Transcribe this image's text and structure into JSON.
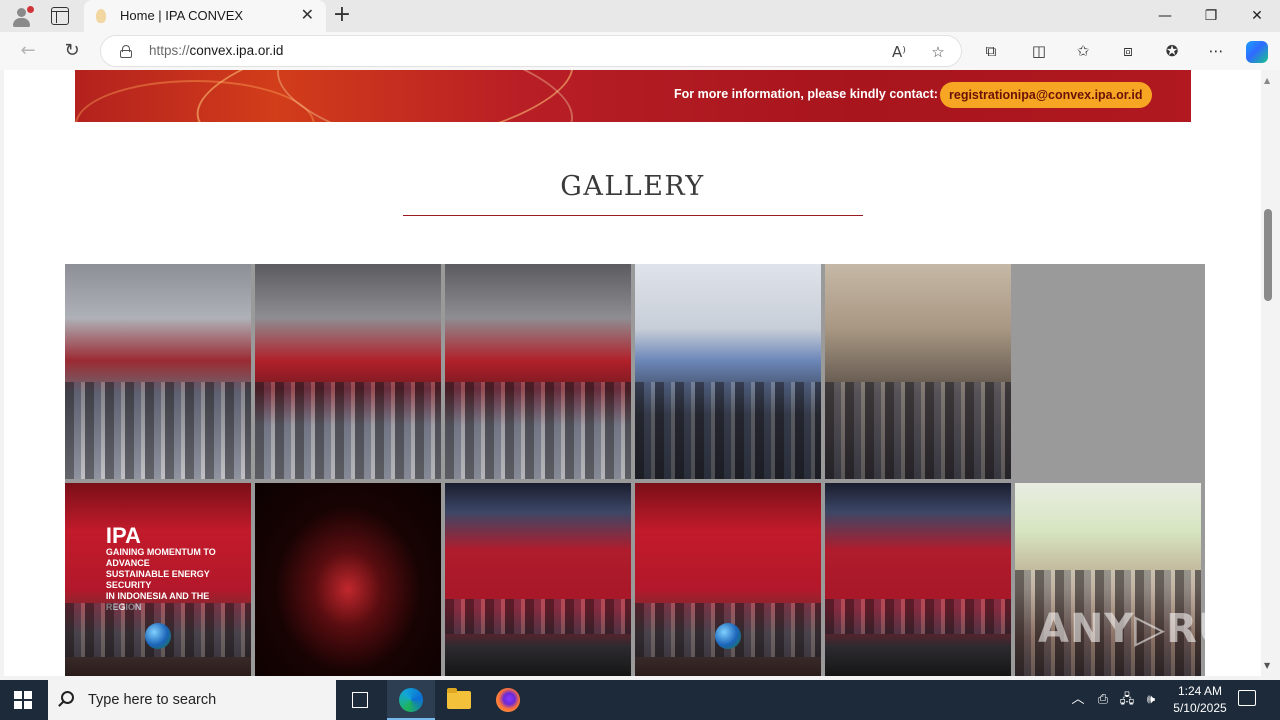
{
  "browser": {
    "tab_title": "Home | IPA CONVEX",
    "tab_close": "✕",
    "new_tab": "+",
    "url_scheme": "https://",
    "url_host": "convex.ipa.or.id",
    "window_controls": {
      "minimize": "—",
      "restore": "❐",
      "close": "✕"
    },
    "toolbar_icons": {
      "read_aloud": "A⁾",
      "favorite": "☆",
      "extensions": "⧉",
      "split": "◫",
      "favorites": "✩",
      "collections": "⧈",
      "copilot_health": "✪",
      "more": "⋯"
    },
    "nav": {
      "back": "←",
      "reload": "↻"
    }
  },
  "page": {
    "banner": {
      "info_text": "For more information, please kindly contact:",
      "email": "registrationipa@convex.ipa.or.id"
    },
    "gallery_title": "GALLERY",
    "stage_photos": {
      "ipa": "IPA",
      "line1": "GAINING MOMENTUM TO ADVANCE",
      "line2": "SUSTAINABLE ENERGY SECURITY",
      "line3": "IN INDONESIA AND THE REGION"
    }
  },
  "watermark": "ANY▷RUN",
  "taskbar": {
    "search_placeholder": "Type here to search",
    "time": "1:24 AM",
    "date": "5/10/2025",
    "tray": {
      "chevron": "︿",
      "network": "🖧",
      "volume": "🕪"
    }
  },
  "colors": {
    "accent_rule": "#9a1c20",
    "banner_red": "#b3211e",
    "email_pill": "#f6a623",
    "taskbar": "#1c2a3a"
  }
}
